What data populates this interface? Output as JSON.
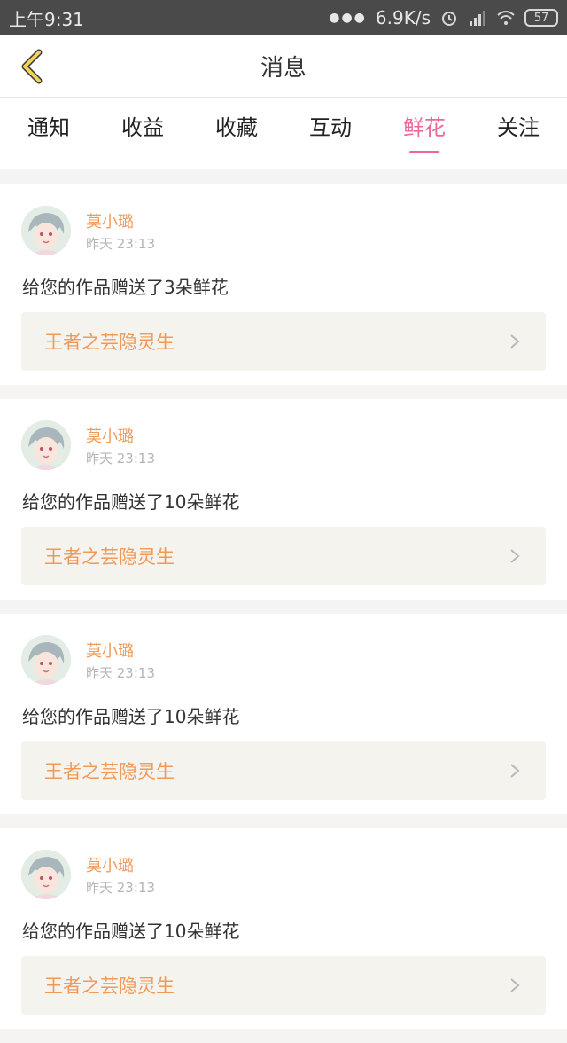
{
  "status_bar": {
    "time": "上午9:31",
    "net_speed": "6.9K/s",
    "battery": "57",
    "colors": {
      "bg": "#4a4a4a",
      "fg": "#e8e8e8"
    }
  },
  "header": {
    "title": "消息",
    "back_icon": "chevron-left-icon",
    "back_icon_color": "#f0d25a"
  },
  "tabs": [
    {
      "label": "通知",
      "active": false
    },
    {
      "label": "收益",
      "active": false
    },
    {
      "label": "收藏",
      "active": false
    },
    {
      "label": "互动",
      "active": false
    },
    {
      "label": "鲜花",
      "active": true
    },
    {
      "label": "关注",
      "active": false
    }
  ],
  "accent_color": "#e9679b",
  "messages": [
    {
      "user": "莫小璐",
      "time": "昨天 23:13",
      "text": "给您的作品赠送了3朵鲜花",
      "work": "王者之芸隐灵生"
    },
    {
      "user": "莫小璐",
      "time": "昨天 23:13",
      "text": "给您的作品赠送了10朵鲜花",
      "work": "王者之芸隐灵生"
    },
    {
      "user": "莫小璐",
      "time": "昨天 23:13",
      "text": "给您的作品赠送了10朵鲜花",
      "work": "王者之芸隐灵生"
    },
    {
      "user": "莫小璐",
      "time": "昨天 23:13",
      "text": "给您的作品赠送了10朵鲜花",
      "work": "王者之芸隐灵生"
    }
  ]
}
